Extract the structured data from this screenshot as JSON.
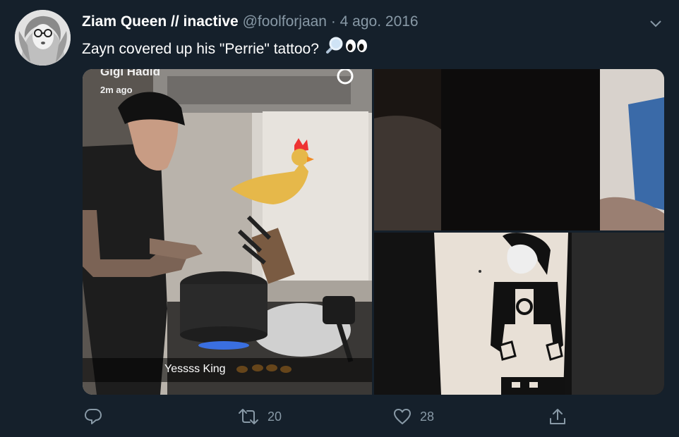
{
  "tweet": {
    "display_name": "Ziam Queen // inactive",
    "handle": "@foolforjaan",
    "separator": "·",
    "date": "4 ago. 2016",
    "text": "Zayn covered up his \"Perrie\" tattoo?",
    "emojis": [
      "magnifying-glass-icon",
      "eyes-icon"
    ],
    "media": {
      "snap_name": "Gigi Hadid",
      "snap_time": "2m ago",
      "snap_caption": "Yessss King"
    },
    "actions": {
      "reply_count": "",
      "retweet_count": "20",
      "like_count": "28"
    }
  },
  "colors": {
    "background": "#15202b",
    "secondary_text": "#8899a6",
    "primary_text": "#ffffff"
  }
}
